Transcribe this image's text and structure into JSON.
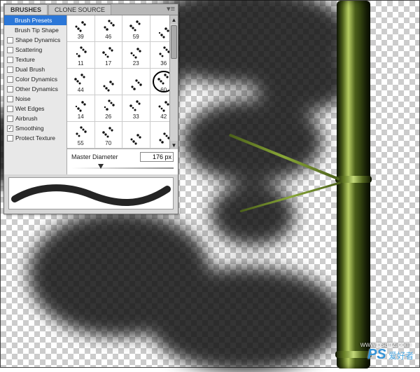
{
  "tabs": {
    "brushes": "BRUSHES",
    "clone": "CLONE SOURCE"
  },
  "sidebar": {
    "presets": "Brush Presets",
    "tip": "Brush Tip Shape",
    "items": [
      {
        "label": "Shape Dynamics",
        "checked": false
      },
      {
        "label": "Scattering",
        "checked": false
      },
      {
        "label": "Texture",
        "checked": false
      },
      {
        "label": "Dual Brush",
        "checked": false
      },
      {
        "label": "Color Dynamics",
        "checked": false
      },
      {
        "label": "Other Dynamics",
        "checked": false
      },
      {
        "label": "Noise",
        "checked": false
      },
      {
        "label": "Wet Edges",
        "checked": false
      },
      {
        "label": "Airbrush",
        "checked": false
      },
      {
        "label": "Smoothing",
        "checked": true
      },
      {
        "label": "Protect Texture",
        "checked": false
      }
    ]
  },
  "brushes": [
    {
      "size": "39",
      "sel": false
    },
    {
      "size": "46",
      "sel": false
    },
    {
      "size": "59",
      "sel": false
    },
    {
      "size": "",
      "sel": false
    },
    {
      "size": "11",
      "sel": false
    },
    {
      "size": "17",
      "sel": false
    },
    {
      "size": "23",
      "sel": false
    },
    {
      "size": "36",
      "sel": false
    },
    {
      "size": "44",
      "sel": false
    },
    {
      "size": "",
      "sel": false
    },
    {
      "size": "",
      "sel": false
    },
    {
      "size": "60",
      "sel": true
    },
    {
      "size": "14",
      "sel": false
    },
    {
      "size": "26",
      "sel": false
    },
    {
      "size": "33",
      "sel": false
    },
    {
      "size": "42",
      "sel": false
    },
    {
      "size": "55",
      "sel": false
    },
    {
      "size": "70",
      "sel": false
    },
    {
      "size": "",
      "sel": false
    },
    {
      "size": "",
      "sel": false
    }
  ],
  "diameter": {
    "label": "Master Diameter",
    "value": "176 px"
  },
  "watermark": {
    "brand": "PS",
    "text": "爱好者",
    "url": "www.psanz.com"
  }
}
